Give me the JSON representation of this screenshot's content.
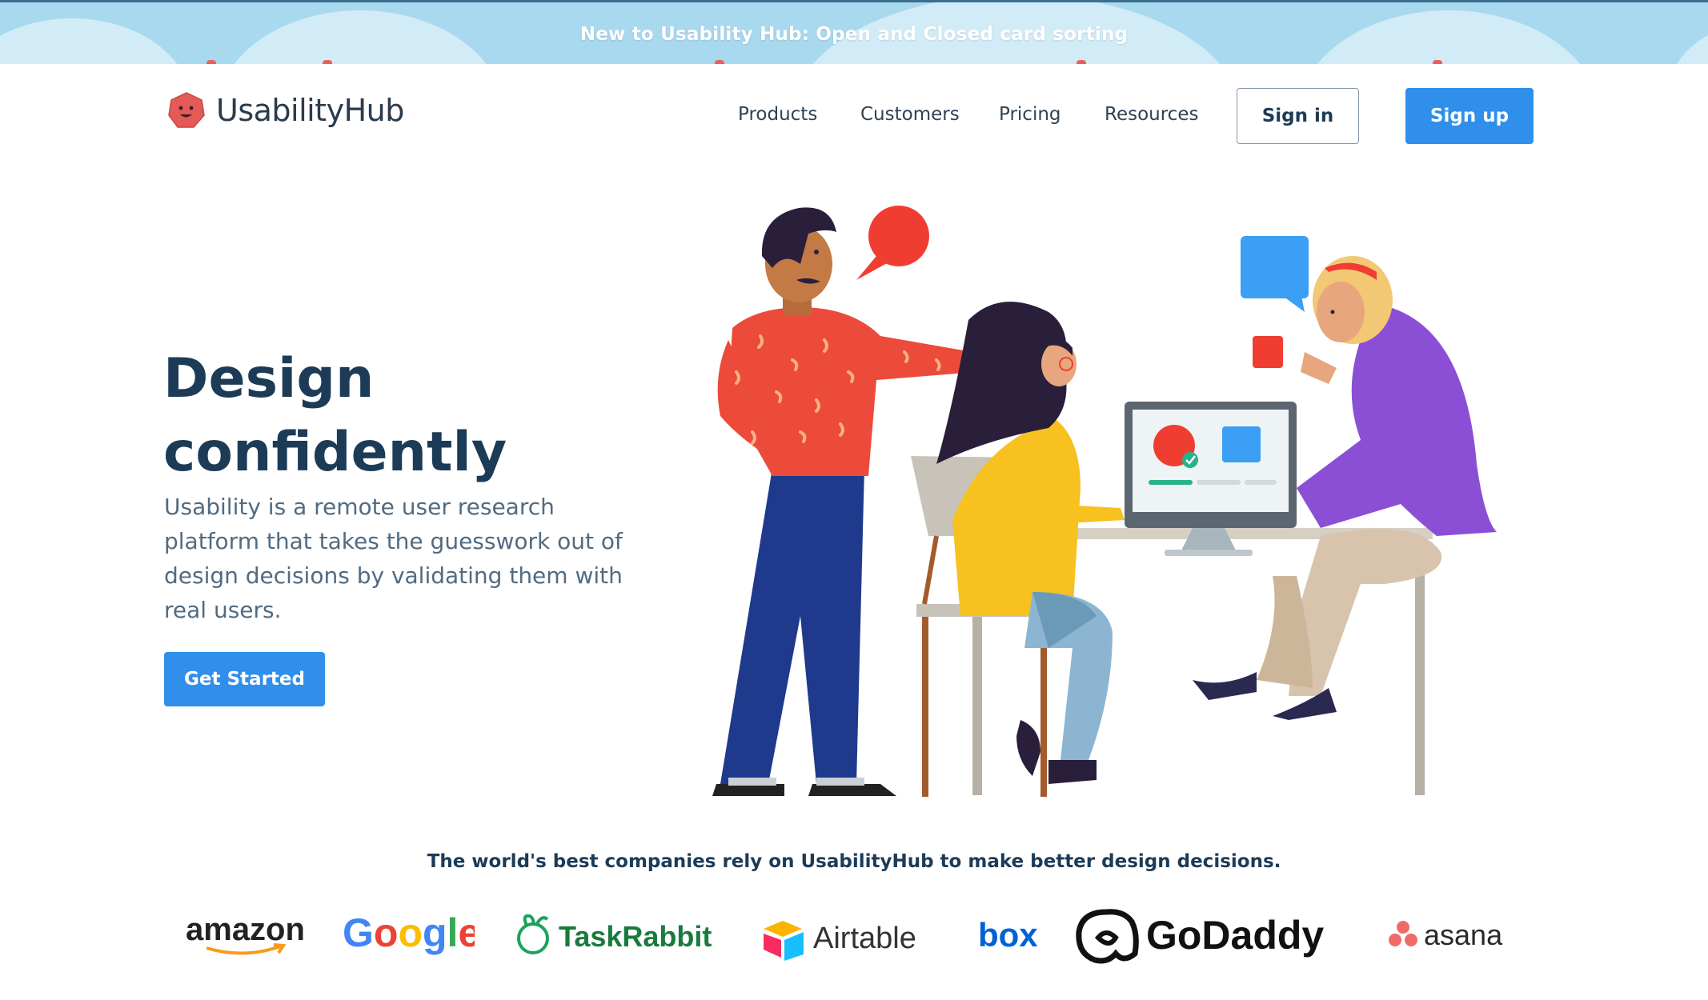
{
  "banner": {
    "text": "New to Usability Hub: Open and Closed card sorting"
  },
  "header": {
    "logo_text": "UsabilityHub",
    "logo_icon": "hexagon-face-icon",
    "nav": [
      {
        "label": "Products"
      },
      {
        "label": "Customers"
      },
      {
        "label": "Pricing"
      },
      {
        "label": "Resources"
      }
    ],
    "sign_in": "Sign in",
    "sign_up": "Sign up"
  },
  "hero": {
    "title": "Design confidently",
    "subtitle": "Usability is a remote user research platform that takes the guesswork out of design decisions by validating them with real users.",
    "cta": "Get Started"
  },
  "trust": {
    "headline": "The world's best companies rely on UsabilityHub to make better design decisions.",
    "brands": [
      "amazon",
      "Google",
      "TaskRabbit",
      "Airtable",
      "box",
      "GoDaddy",
      "asana"
    ]
  },
  "colors": {
    "primary": "#2f8fea",
    "heading": "#1c3b57",
    "banner": "#a9d9ef",
    "logo": "#e45a56"
  }
}
